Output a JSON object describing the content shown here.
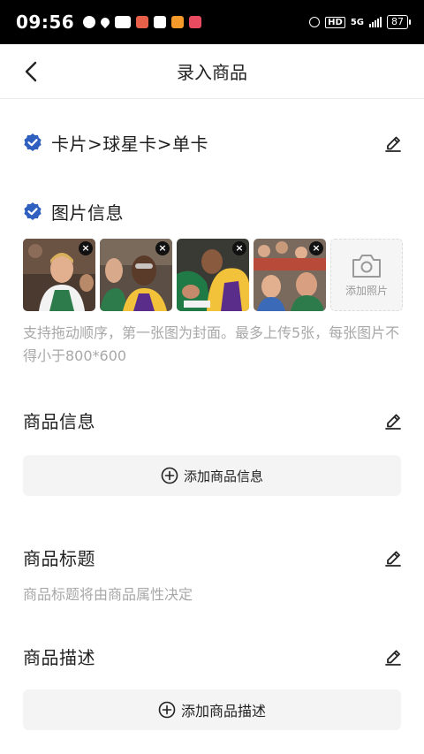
{
  "status_bar": {
    "time": "09:56",
    "network": "5G",
    "hd": "HD",
    "battery": "87"
  },
  "header": {
    "title": "录入商品"
  },
  "category": {
    "path": "卡片>球星卡>单卡"
  },
  "images": {
    "title": "图片信息",
    "add_label": "添加照片",
    "hint": "支持拖动顺序，第一张图为封面。最多上传5张，每张图片不得小于800*600"
  },
  "product_info": {
    "title": "商品信息",
    "add_label": "添加商品信息"
  },
  "product_title": {
    "title": "商品标题",
    "hint": "商品标题将由商品属性决定"
  },
  "product_desc": {
    "title": "商品描述",
    "add_label": "添加商品描述"
  },
  "colors": {
    "accent_blue": "#2f5fbf",
    "text": "#222222",
    "hint": "#a8a8a8"
  }
}
